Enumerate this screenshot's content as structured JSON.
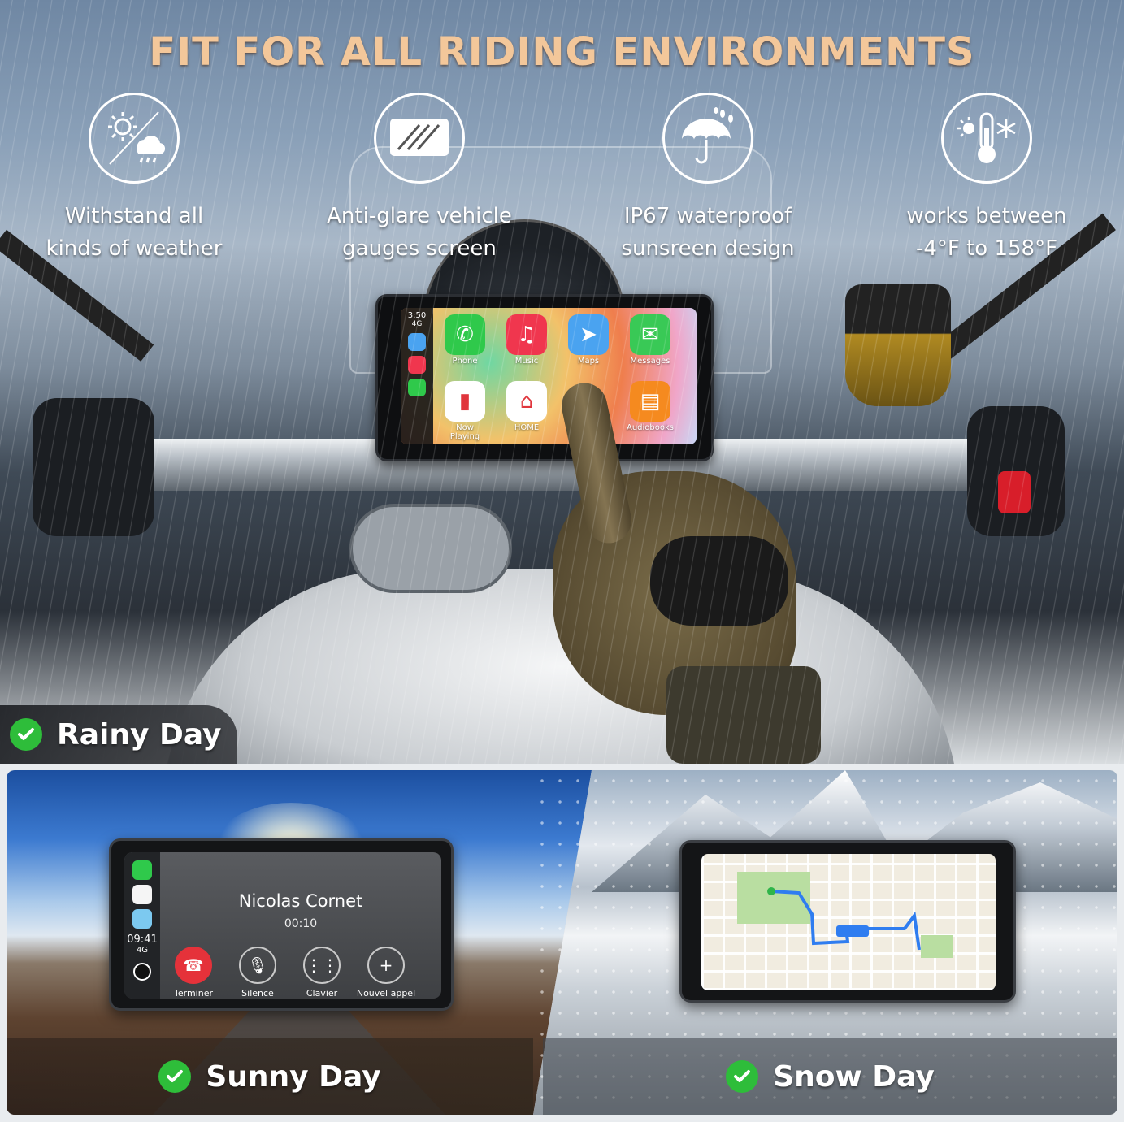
{
  "headline": "FIT FOR ALL RIDING ENVIRONMENTS",
  "features": [
    {
      "icon": "sun-cloud-rain-icon",
      "label": "Withstand all\nkinds of weather"
    },
    {
      "icon": "anti-glare-screen-icon",
      "label": "Anti-glare vehicle\ngauges screen"
    },
    {
      "icon": "umbrella-rain-icon",
      "label": "IP67 waterproof\nsunsreen design"
    },
    {
      "icon": "thermometer-sun-snow-icon",
      "label": "works  between\n-4°F  to 158°F"
    }
  ],
  "carplay": {
    "time": "3:50",
    "network": "4G",
    "apps": [
      {
        "name": "Phone",
        "icon": "phone-app-icon",
        "color": "#2fc94b",
        "glyph": "✆"
      },
      {
        "name": "Music",
        "icon": "music-app-icon",
        "color": "#f0364e",
        "glyph": "♫"
      },
      {
        "name": "Maps",
        "icon": "maps-app-icon",
        "color": "#4aa3f0",
        "glyph": "➤"
      },
      {
        "name": "Messages",
        "icon": "messages-app-icon",
        "color": "#39c956",
        "glyph": "✉"
      },
      {
        "name": "Now Playing",
        "icon": "now-playing-app-icon",
        "color": "#ffffff",
        "glyph": "▮"
      },
      {
        "name": "HOME",
        "icon": "home-app-icon",
        "color": "#ffffff",
        "glyph": "⌂"
      },
      {
        "name": "Audiobooks",
        "icon": "audiobooks-app-icon",
        "color": "#f58a1f",
        "glyph": "▤"
      }
    ]
  },
  "badges": {
    "rainy": "Rainy Day",
    "sunny": "Sunny Day",
    "snow": "Snow Day"
  },
  "call": {
    "caller": "Nicolas Cornet",
    "duration": "00:10",
    "time": "09:41",
    "network": "4G",
    "buttons": [
      {
        "label": "Terminer",
        "glyph": "☎",
        "color": "#e5323a"
      },
      {
        "label": "Silence",
        "glyph": "🎙",
        "color": "transparent"
      },
      {
        "label": "Clavier",
        "glyph": "⋮⋮",
        "color": "transparent"
      },
      {
        "label": "Nouvel appel",
        "glyph": "+",
        "color": "transparent"
      }
    ]
  },
  "colors": {
    "headline": "#f3c79a",
    "check": "#2ebd3a"
  }
}
